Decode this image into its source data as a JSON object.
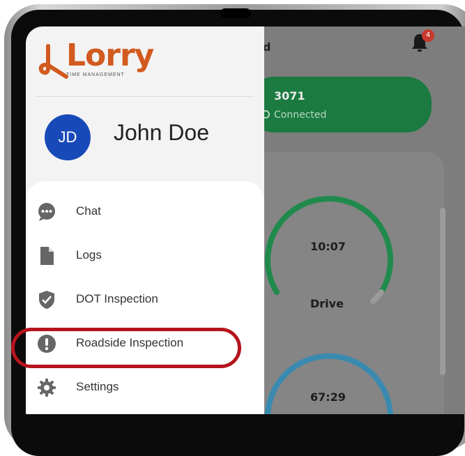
{
  "brand": {
    "name": "Lorry",
    "tagline": "TIME MANAGEMENT",
    "color": "#d25a1f"
  },
  "background_app": {
    "title_fragment": "d",
    "notification_count": "4",
    "vehicle": {
      "number": "3071",
      "status": "Connected"
    },
    "gauges": [
      {
        "value": "10:07",
        "label": "Drive",
        "color": "#1f8a4c"
      },
      {
        "value": "67:29",
        "label": "",
        "color": "#3a8ab0"
      }
    ]
  },
  "user": {
    "initials": "JD",
    "name": "John Doe",
    "avatar_color": "#1849b8"
  },
  "menu": {
    "items": [
      {
        "label": "Chat",
        "icon": "chat-bubble-icon"
      },
      {
        "label": "Logs",
        "icon": "document-icon"
      },
      {
        "label": "DOT Inspection",
        "icon": "shield-check-icon"
      },
      {
        "label": "Roadside Inspection",
        "icon": "exclamation-circle-icon",
        "highlighted": true
      },
      {
        "label": "Settings",
        "icon": "gear-icon"
      }
    ]
  },
  "highlight_color": "#b5141d"
}
